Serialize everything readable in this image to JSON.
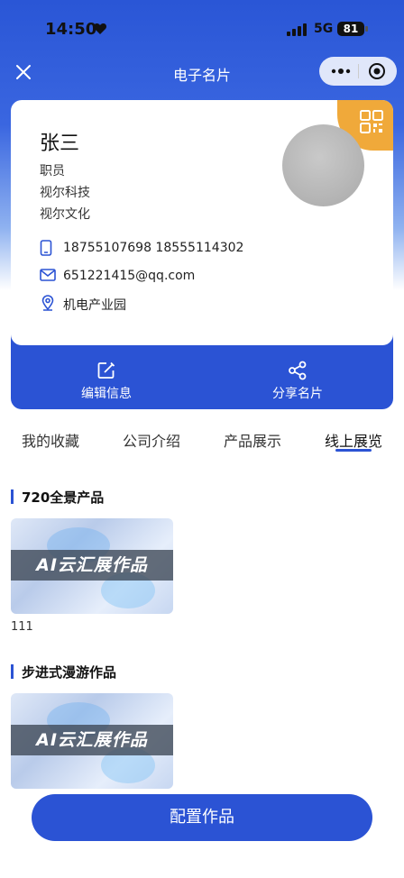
{
  "status": {
    "time": "14:50",
    "network": "5G",
    "battery": "81"
  },
  "nav": {
    "title": "电子名片"
  },
  "card": {
    "name": "张三",
    "title": "职员",
    "company1": "视尔科技",
    "company2": "视尔文化",
    "phone": "18755107698   18555114302",
    "email": "651221415@qq.com",
    "address": "机电产业园"
  },
  "actions": {
    "edit": "编辑信息",
    "share": "分享名片"
  },
  "tabs": [
    "我的收藏",
    "公司介绍",
    "产品展示",
    "线上展览"
  ],
  "active_tab": "线上展览",
  "sections": [
    {
      "title": "720全景产品",
      "thumb_text": "AI云汇展作品",
      "item_label": "111"
    },
    {
      "title": "步进式漫游作品",
      "thumb_text": "AI云汇展作品"
    }
  ],
  "config_button": "配置作品",
  "colors": {
    "primary": "#2b53d4",
    "qr_badge": "#f0a93a"
  }
}
